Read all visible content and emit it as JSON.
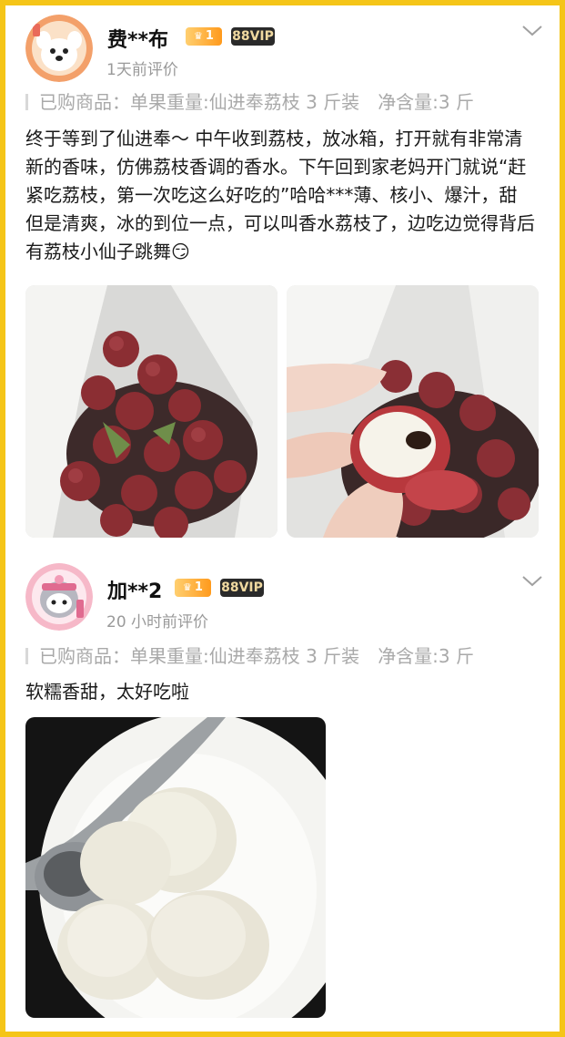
{
  "reviews": [
    {
      "user": "费**布",
      "level": "1",
      "vip": "88VIP",
      "time": "1天前评价",
      "spec_label": "已购商品：",
      "spec": "单果重量:仙进奉荔枝 3 斤装",
      "net_weight": "净含量:3 斤",
      "text": "终于等到了仙进奉～ 中午收到荔枝，放冰箱，打开就有非常清新的香味，仿佛荔枝香调的香水。下午回到家老妈开门就说“赶紧吃荔枝，第一次吃这么好吃的”哈哈***薄、核小、爆汁，甜但是清爽，冰的到位一点，可以叫香水荔枝了，边吃边觉得背后有荔枝小仙子跳舞😏"
    },
    {
      "user": "加**2",
      "level": "1",
      "vip": "88VIP",
      "time": "20 小时前评价",
      "spec_label": "已购商品：",
      "spec": "单果重量:仙进奉荔枝 3 斤装",
      "net_weight": "净含量:3 斤",
      "text": "软糯香甜，太好吃啦"
    }
  ],
  "colors": {
    "frame": "#f5c518",
    "vip_bg": "#2a2a2a",
    "level_badge": "#ff9a1c"
  }
}
